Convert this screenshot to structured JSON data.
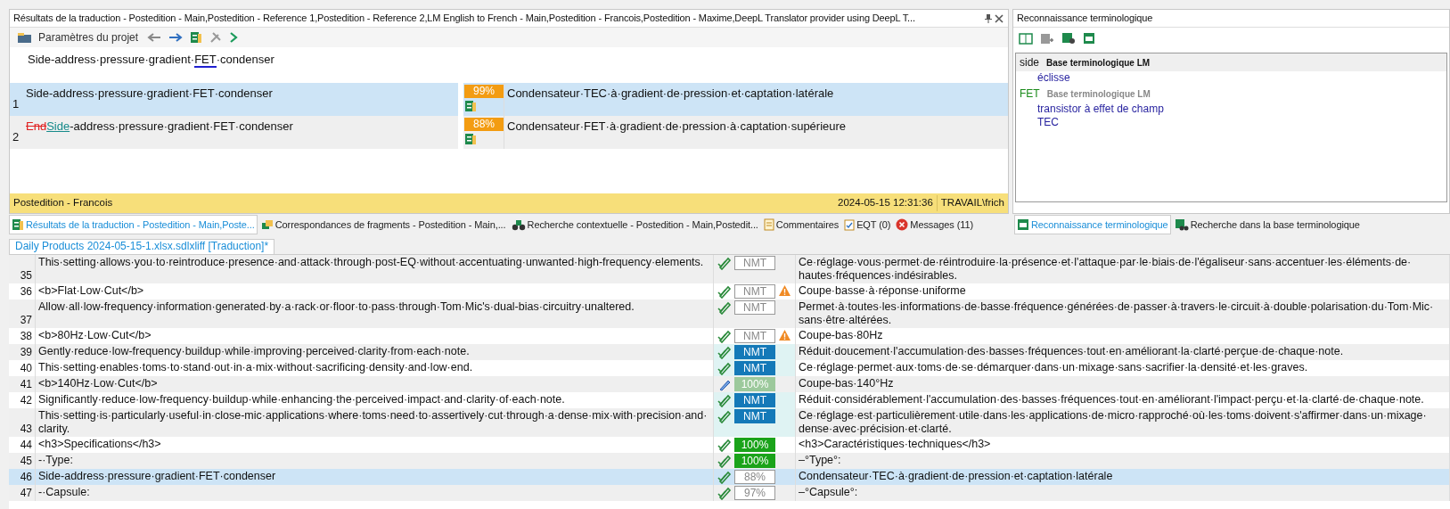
{
  "results_panel": {
    "title": "Résultats de la traduction - Postedition - Main,Postedition - Reference 1,Postedition - Reference 2,LM English to French - Main,Postedition - Francois,Postedition - Maxime,DeepL Translator provider using DeepL T...",
    "toolbar": {
      "project_settings": "Paramètres du projet"
    },
    "source": [
      {
        "text": "Side-address·pressure·gradient·",
        "term": false
      },
      {
        "text": "FET",
        "term": true
      },
      {
        "text": "·condenser",
        "term": false
      }
    ],
    "results": [
      {
        "number": "1",
        "selected": true,
        "source": [
          {
            "text": "Side-address·pressure·gradient·FET·condenser",
            "kind": "plain"
          }
        ],
        "score": "99%",
        "target": "Condensateur·TEC·à·gradient·de·pression·et·captation·latérale"
      },
      {
        "number": "2",
        "selected": false,
        "source": [
          {
            "text": "End",
            "kind": "deleted"
          },
          {
            "text": "Side",
            "kind": "inserted"
          },
          {
            "text": "-address·pressure·gradient·FET·condenser",
            "kind": "plain"
          }
        ],
        "score": "88%",
        "target": "Condensateur·FET·à·gradient·de·pression·à·captation·supérieure"
      }
    ],
    "status_bar": {
      "origin": "Postedition - Francois",
      "date": "2024-05-15 12:31:36",
      "user": "TRAVAIL\\frich"
    },
    "tabs": [
      {
        "label": "Résultats de la traduction - Postedition - Main,Poste...",
        "selected": true
      },
      {
        "label": "Correspondances de fragments - Postedition - Main,...",
        "selected": false
      },
      {
        "label": "Recherche contextuelle - Postedition - Main,Postedit...",
        "selected": false
      },
      {
        "label": "Commentaires",
        "selected": false
      },
      {
        "label": "EQT (0)",
        "selected": false
      },
      {
        "label": "Messages (11)",
        "selected": false
      }
    ]
  },
  "term_panel": {
    "title": "Reconnaissance terminologique",
    "entries": [
      {
        "term": "side",
        "base": "Base terminologique LM",
        "selected": true,
        "translations": [
          "éclisse"
        ]
      },
      {
        "term": "FET",
        "base": "Base terminologique LM",
        "selected": false,
        "translations": [
          "transistor à effet de champ",
          "TEC"
        ]
      }
    ],
    "tabs": [
      {
        "label": "Reconnaissance terminologique",
        "selected": true
      },
      {
        "label": "Recherche dans la base terminologique",
        "selected": false
      }
    ]
  },
  "document_tab": "Daily Products 2024-05-15-1.xlsx.sdlxliff [Traduction]*",
  "grid": {
    "rows": [
      {
        "number": "35",
        "source": "This·setting·allows·you·to·reintroduce·presence·and·attack·through·post-EQ·without·accentuating·unwanted·high-frequency·elements.",
        "target": "Ce·réglage·vous·permet·de·réintroduire·la·présence·et·l'attaque·par·le·biais·de·l'égaliseur·sans·accentuer·les·éléments·de·hautes·fréquences·indésirables.",
        "status": {
          "label": "NMT",
          "kind": "draft"
        },
        "confirmed": true,
        "warning": false,
        "selected": false
      },
      {
        "number": "36",
        "source": "<b>Flat·Low·Cut</b>",
        "target": "Coupe·basse·à·réponse·uniforme",
        "status": {
          "label": "NMT",
          "kind": "draft"
        },
        "confirmed": true,
        "warning": true,
        "selected": false
      },
      {
        "number": "37",
        "source": "Allow·all·low-frequency·information·generated·by·a·rack·or·floor·to·pass·through·Tom·Mic's·dual-bias·circuitry·unaltered.",
        "target": "Permet·à·toutes·les·informations·de·basse·fréquence·générées·de·passer·à·travers·le·circuit·à·double·polarisation·du·Tom·Mic·sans·être·altérées.",
        "status": {
          "label": "NMT",
          "kind": "draft"
        },
        "confirmed": true,
        "warning": false,
        "selected": false
      },
      {
        "number": "38",
        "source": "<b>80Hz·Low·Cut</b>",
        "target": "Coupe-bas·80Hz",
        "status": {
          "label": "NMT",
          "kind": "draft"
        },
        "confirmed": true,
        "warning": true,
        "selected": false
      },
      {
        "number": "39",
        "source": "Gently·reduce·low-frequency·buildup·while·improving·perceived·clarity·from·each·note.",
        "target": "Réduit·doucement·l'accumulation·des·basses·fréquences·tout·en·améliorant·la·clarté·perçue·de·chaque·note.",
        "status": {
          "label": "NMT",
          "kind": "nmt"
        },
        "confirmed": true,
        "warning": false,
        "selected": false
      },
      {
        "number": "40",
        "source": "This·setting·enables·toms·to·stand·out·in·a·mix·without·sacrificing·density·and·low·end.",
        "target": "Ce·réglage·permet·aux·toms·de·se·démarquer·dans·un·mixage·sans·sacrifier·la·densité·et·les·graves.",
        "status": {
          "label": "NMT",
          "kind": "nmt"
        },
        "confirmed": true,
        "warning": false,
        "selected": false
      },
      {
        "number": "41",
        "source": "<b>140Hz·Low·Cut</b>",
        "target": "Coupe-bas·140°Hz",
        "status": {
          "label": "100%",
          "kind": "exact-draft"
        },
        "confirmed": false,
        "warning": false,
        "selected": false
      },
      {
        "number": "42",
        "source": "Significantly·reduce·low-frequency·buildup·while·enhancing·the·perceived·impact·and·clarity·of·each·note.",
        "target": "Réduit·considérablement·l'accumulation·des·basses·fréquences·tout·en·améliorant·l'impact·perçu·et·la·clarté·de·chaque·note.",
        "status": {
          "label": "NMT",
          "kind": "nmt"
        },
        "confirmed": true,
        "warning": false,
        "selected": false
      },
      {
        "number": "43",
        "source": "This·setting·is·particularly·useful·in·close-mic·applications·where·toms·need·to·assertively·cut·through·a·dense·mix·with·precision·and·clarity.",
        "target": "Ce·réglage·est·particulièrement·utile·dans·les·applications·de·micro·rapproché·où·les·toms·doivent·s'affirmer·dans·un·mixage·dense·avec·précision·et·clarté.",
        "status": {
          "label": "NMT",
          "kind": "nmt"
        },
        "confirmed": true,
        "warning": false,
        "selected": false
      },
      {
        "number": "44",
        "source": "<h3>Specifications</h3>",
        "target": "<h3>Caractéristiques·techniques</h3>",
        "status": {
          "label": "100%",
          "kind": "exact"
        },
        "confirmed": true,
        "warning": false,
        "selected": false
      },
      {
        "number": "45",
        "source": "-·Type:",
        "target": "–°Type°:",
        "status": {
          "label": "100%",
          "kind": "exact"
        },
        "confirmed": true,
        "warning": false,
        "selected": false
      },
      {
        "number": "46",
        "source": "Side-address·pressure·gradient·FET·condenser",
        "target": "Condensateur·TEC·à·gradient·de·pression·et·captation·latérale",
        "status": {
          "label": "88%",
          "kind": "fuzzy"
        },
        "confirmed": true,
        "warning": false,
        "selected": true
      },
      {
        "number": "47",
        "source": "-·Capsule:",
        "target": "–°Capsule°:",
        "status": {
          "label": "97%",
          "kind": "fuzzy"
        },
        "confirmed": true,
        "warning": false,
        "selected": false
      }
    ]
  }
}
